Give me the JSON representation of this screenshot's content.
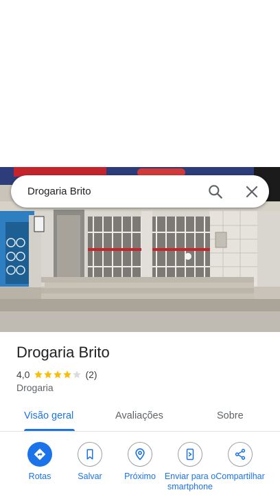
{
  "search": {
    "query": "Drogaria Brito",
    "search_icon": "search-icon",
    "close_icon": "close-icon"
  },
  "photo": {
    "icon": "storefront-photo"
  },
  "place": {
    "name": "Drogaria Brito",
    "rating": "4,0",
    "rating_value": 4.0,
    "stars_max": 5,
    "review_count": "(2)",
    "category": "Drogaria"
  },
  "tabs": [
    {
      "label": "Visão geral",
      "active": true
    },
    {
      "label": "Avaliações",
      "active": false
    },
    {
      "label": "Sobre",
      "active": false
    }
  ],
  "actions": [
    {
      "label": "Rotas",
      "icon": "directions-icon"
    },
    {
      "label": "Salvar",
      "icon": "bookmark-icon"
    },
    {
      "label": "Próximo",
      "icon": "nearby-icon"
    },
    {
      "label": "Enviar para o smartphone",
      "icon": "send-to-phone-icon"
    },
    {
      "label": "Compartilhar",
      "icon": "share-icon"
    }
  ],
  "colors": {
    "accent": "#1a73e8",
    "star": "#fbbc04",
    "star_empty": "#dadce0"
  }
}
